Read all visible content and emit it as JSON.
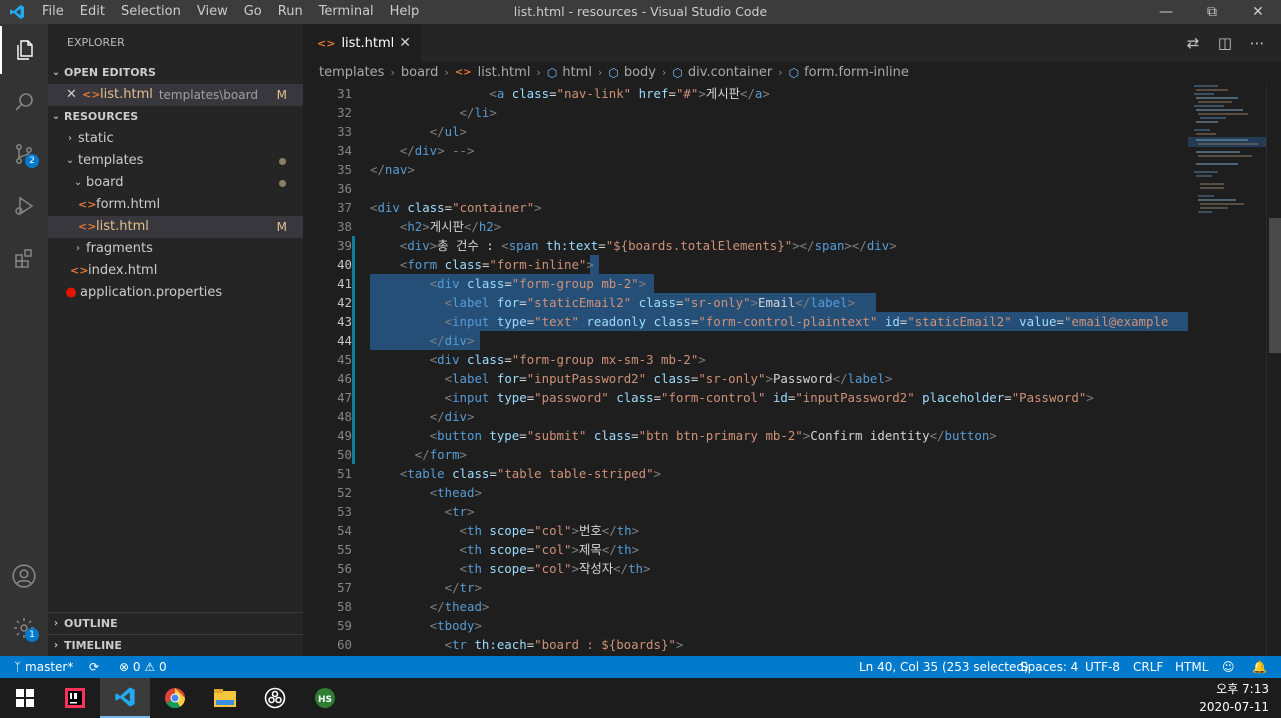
{
  "window": {
    "title": "list.html - resources - Visual Studio Code"
  },
  "menu": [
    "File",
    "Edit",
    "Selection",
    "View",
    "Go",
    "Run",
    "Terminal",
    "Help"
  ],
  "activity": {
    "scm_badge": "2",
    "settings_badge": "1"
  },
  "explorer": {
    "title": "EXPLORER",
    "open_editors": "OPEN EDITORS",
    "open_file": {
      "name": "list.html",
      "path": "templates\\board",
      "status": "M"
    },
    "resources": "RESOURCES",
    "tree": [
      {
        "label": "static"
      },
      {
        "label": "templates"
      },
      {
        "label": "board"
      },
      {
        "label": "form.html"
      },
      {
        "label": "list.html",
        "status": "M"
      },
      {
        "label": "fragments"
      },
      {
        "label": "index.html"
      },
      {
        "label": "application.properties"
      }
    ],
    "outline": "OUTLINE",
    "timeline": "TIMELINE"
  },
  "tab": {
    "label": "list.html"
  },
  "breadcrumb": [
    "templates",
    "board",
    "list.html",
    "html",
    "body",
    "div.container",
    "form.form-inline"
  ],
  "code": {
    "numbers": [
      "31",
      "32",
      "33",
      "34",
      "35",
      "36",
      "37",
      "38",
      "39",
      "40",
      "41",
      "42",
      "43",
      "44",
      "45",
      "46",
      "47",
      "48",
      "49",
      "50",
      "51",
      "52",
      "53",
      "54",
      "55",
      "56",
      "57",
      "58",
      "59",
      "60"
    ]
  },
  "status": {
    "branch": "master*",
    "errors": "0",
    "warnings": "0",
    "position": "Ln 40, Col 35 (253 selected)",
    "spaces": "Spaces: 4",
    "encoding": "UTF-8",
    "eol": "CRLF",
    "language": "HTML"
  },
  "clock": {
    "time": "오후 7:13",
    "date": "2020-07-11"
  }
}
